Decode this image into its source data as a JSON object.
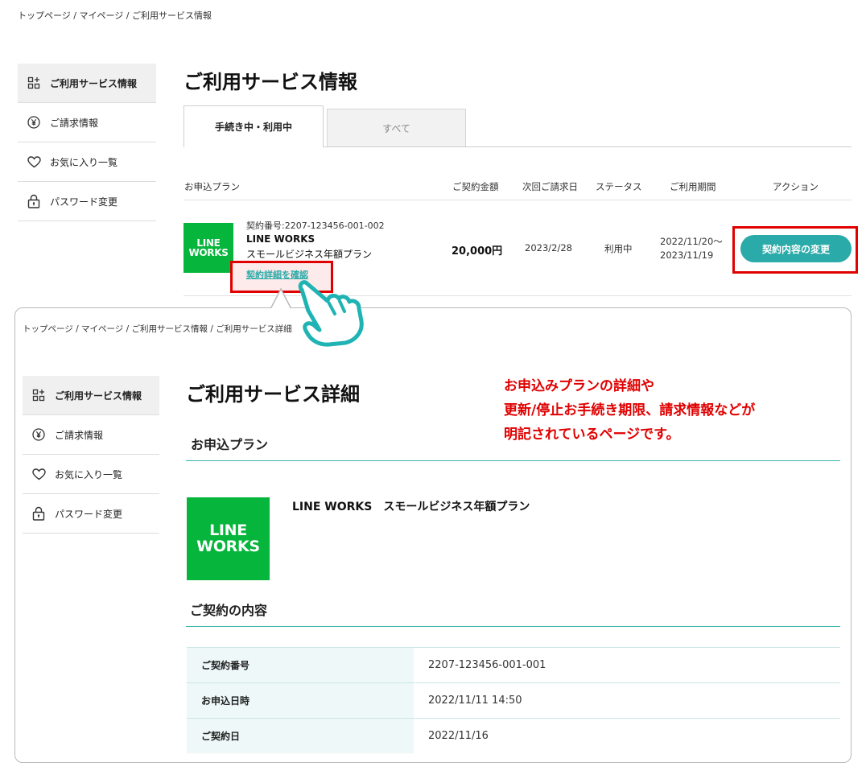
{
  "top": {
    "breadcrumb": "トップページ / マイページ / ご利用サービス情報",
    "sidebar": [
      {
        "label": "ご利用サービス情報",
        "icon": "grid-plus-icon"
      },
      {
        "label": "ご請求情報",
        "icon": "yen-icon"
      },
      {
        "label": "お気に入り一覧",
        "icon": "heart-icon"
      },
      {
        "label": "パスワード変更",
        "icon": "lock-icon"
      }
    ],
    "title": "ご利用サービス情報",
    "tabs": {
      "active": "手続き中・利用中",
      "inactive": "すべて"
    },
    "columns": {
      "plan": "お申込プラン",
      "amount": "ご契約金額",
      "next_bill": "次回ご請求日",
      "status": "ステータス",
      "period": "ご利用期間",
      "action": "アクション"
    },
    "row": {
      "logo_line1": "LINE",
      "logo_line2": "WORKS",
      "contract_no": "契約番号:2207-123456-001-002",
      "service": "LINE WORKS",
      "plan": "スモールビジネス年額プラン",
      "detail_link": "契約詳細を確認",
      "amount": "20,000円",
      "next_bill": "2023/2/28",
      "status": "利用中",
      "period_start": "2022/11/20～",
      "period_end": "2023/11/19",
      "change_button": "契約内容の変更"
    }
  },
  "detail": {
    "breadcrumb": "トップページ / マイページ / ご利用サービス情報 / ご利用サービス詳細",
    "title": "ご利用サービス詳細",
    "section_plan": "お申込プラン",
    "plan_name": "LINE WORKS　スモールビジネス年額プラン",
    "logo_line1": "LINE",
    "logo_line2": "WORKS",
    "section_contract": "ご契約の内容",
    "rows": [
      {
        "key": "ご契約番号",
        "value": "2207-123456-001-001"
      },
      {
        "key": "お申込日時",
        "value": "2022/11/11 14:50"
      },
      {
        "key": "ご契約日",
        "value": "2022/11/16"
      }
    ]
  },
  "annotation": {
    "line1": "お申込みプランの詳細や",
    "line2": "更新/停止お手続き期限、請求情報などが",
    "line3": "明記されているページです。",
    "color": "#e00000"
  },
  "colors": {
    "teal": "#2aaaa8",
    "line_green": "#06b53b",
    "highlight_red": "#e00000"
  }
}
